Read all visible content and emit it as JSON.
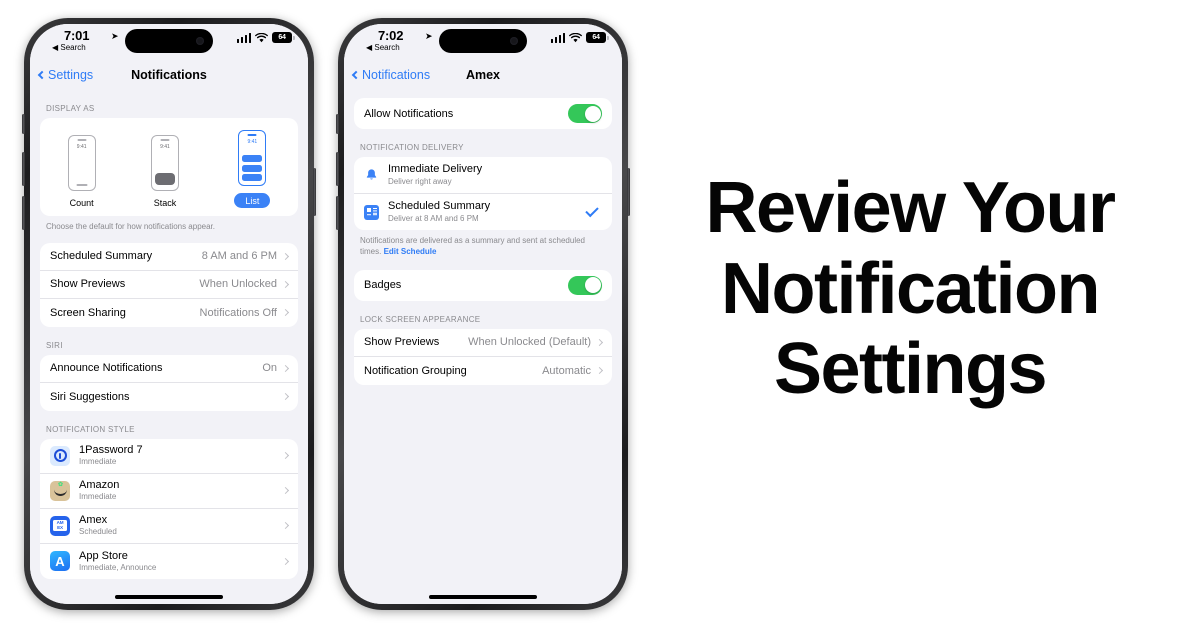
{
  "headline": {
    "line1": "Review Your",
    "line2": "Notification",
    "line3": "Settings"
  },
  "colors": {
    "accent_blue": "#2f7cf6",
    "toggle_green": "#34c759",
    "bg": "#ffffff",
    "screen_bg": "#f2f2f7"
  },
  "phone1": {
    "status": {
      "time": "7:01",
      "location_icon": "location-arrow-icon",
      "back_app": "◀ Search",
      "battery": "64",
      "signal_icon": "cellular-bars-icon",
      "wifi_icon": "wifi-icon"
    },
    "nav": {
      "back_label": "Settings",
      "title": "Notifications"
    },
    "display_as": {
      "header": "DISPLAY AS",
      "footer": "Choose the default for how notifications appear.",
      "mini_time": "9:41",
      "options": [
        {
          "label": "Count",
          "selected": false
        },
        {
          "label": "Stack",
          "selected": false
        },
        {
          "label": "List",
          "selected": true
        }
      ]
    },
    "rows": [
      {
        "label": "Scheduled Summary",
        "value": "8 AM and 6 PM"
      },
      {
        "label": "Show Previews",
        "value": "When Unlocked"
      },
      {
        "label": "Screen Sharing",
        "value": "Notifications Off"
      }
    ],
    "siri": {
      "header": "SIRI",
      "rows": [
        {
          "label": "Announce Notifications",
          "value": "On"
        },
        {
          "label": "Siri Suggestions",
          "value": ""
        }
      ]
    },
    "notification_style": {
      "header": "NOTIFICATION STYLE",
      "apps": [
        {
          "name": "1Password 7",
          "status": "Immediate",
          "icon": "1password-icon"
        },
        {
          "name": "Amazon",
          "status": "Immediate",
          "icon": "amazon-icon"
        },
        {
          "name": "Amex",
          "status": "Scheduled",
          "icon": "amex-icon"
        },
        {
          "name": "App Store",
          "status": "Immediate, Announce",
          "icon": "app-store-icon"
        }
      ]
    }
  },
  "phone2": {
    "status": {
      "time": "7:02",
      "location_icon": "location-arrow-icon",
      "back_app": "◀ Search",
      "battery": "64",
      "signal_icon": "cellular-bars-icon",
      "wifi_icon": "wifi-icon"
    },
    "nav": {
      "back_label": "Notifications",
      "title": "Amex"
    },
    "allow": {
      "label": "Allow Notifications",
      "state": "on"
    },
    "delivery": {
      "header": "NOTIFICATION DELIVERY",
      "options": [
        {
          "title": "Immediate Delivery",
          "subtitle": "Deliver right away",
          "icon": "bell-icon",
          "checked": false
        },
        {
          "title": "Scheduled Summary",
          "subtitle": "Deliver at 8 AM and 6 PM",
          "icon": "summary-icon",
          "checked": true
        }
      ],
      "footer_text": "Notifications are delivered as a summary and sent at scheduled times. ",
      "footer_link": "Edit Schedule"
    },
    "badges": {
      "label": "Badges",
      "state": "on"
    },
    "lock_screen": {
      "header": "LOCK SCREEN APPEARANCE",
      "rows": [
        {
          "label": "Show Previews",
          "value": "When Unlocked (Default)"
        },
        {
          "label": "Notification Grouping",
          "value": "Automatic"
        }
      ]
    }
  }
}
